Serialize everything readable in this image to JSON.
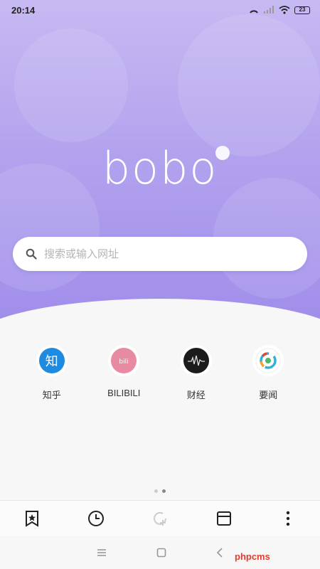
{
  "status": {
    "time": "20:14",
    "battery": "23"
  },
  "logo": {
    "text": "bobo"
  },
  "search": {
    "placeholder": "搜索或输入网址"
  },
  "shortcuts": [
    {
      "label": "知乎",
      "icon": "zhihu-icon",
      "color": "#1e8ae0",
      "glyph": "知"
    },
    {
      "label": "BILIBILI",
      "icon": "bilibili-icon",
      "color": "#e98aa3"
    },
    {
      "label": "财经",
      "icon": "finance-icon",
      "color": "#1b1b1b"
    },
    {
      "label": "要闻",
      "icon": "news-icon",
      "color": "#ffffff"
    }
  ],
  "watermark": {
    "text": "phpcms"
  }
}
